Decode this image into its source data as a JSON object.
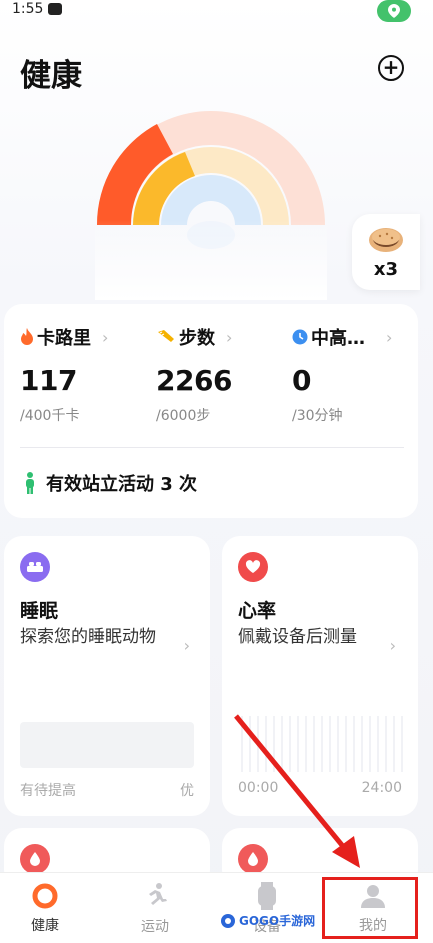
{
  "status_bar": {
    "time": "1:55"
  },
  "header": {
    "title": "健康"
  },
  "rings": {
    "progress_calories": 0.29,
    "progress_steps": 0.38,
    "progress_activity": 0.0
  },
  "badge": {
    "count": "x3"
  },
  "metrics": [
    {
      "label": "卡路里",
      "value": "117",
      "goal": "/400千卡",
      "icon": "flame-icon",
      "color": "#ff6a2b"
    },
    {
      "label": "步数",
      "value": "2266",
      "goal": "/6000步",
      "icon": "shoe-icon",
      "color": "#f5b200"
    },
    {
      "label": "中高…",
      "value": "0",
      "goal": "/30分钟",
      "icon": "clock-icon",
      "color": "#3c8ff0"
    }
  ],
  "stand": {
    "text": "有效站立活动 3 次"
  },
  "sleep": {
    "title": "睡眠",
    "desc": "探索您的睡眠动物",
    "low_label": "有待提高",
    "high_label": "优"
  },
  "heart": {
    "title": "心率",
    "desc": "佩戴设备后测量",
    "start_time": "00:00",
    "end_time": "24:00"
  },
  "nav": {
    "health": "健康",
    "sport": "运动",
    "device": "设备",
    "me": "我的"
  },
  "watermark": {
    "text": "GOGO手游网"
  },
  "colors": {
    "accent_red": "#e5201c",
    "calorie": "#ff6a2b",
    "steps": "#f5b200",
    "activity": "#3c8ff0"
  }
}
